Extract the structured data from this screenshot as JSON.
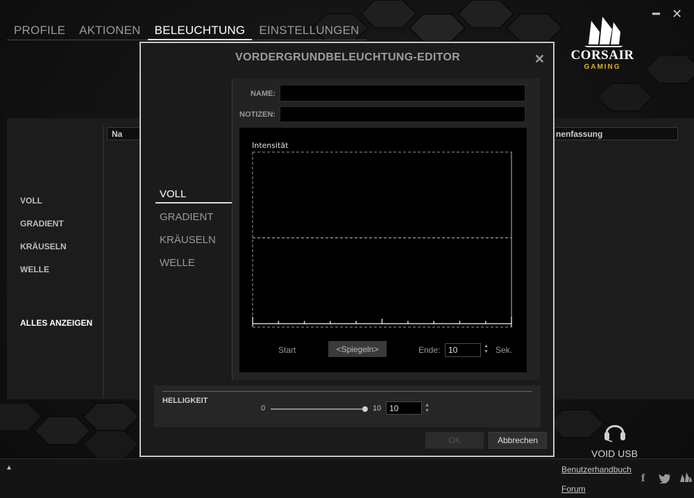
{
  "nav": {
    "tabs": [
      {
        "label": "PROFILE"
      },
      {
        "label": "AKTIONEN"
      },
      {
        "label": "BELEUCHTUNG"
      },
      {
        "label": "EINSTELLUNGEN"
      }
    ],
    "active_tab": "BELEUCHTUNG"
  },
  "window_controls": {
    "minimize": "━",
    "close": "✕"
  },
  "brand": {
    "name": "CORSAIR",
    "subtitle": "GAMING"
  },
  "background": {
    "header_left": "Na",
    "header_right": "nenfassung",
    "left_menu": [
      {
        "label": "VOLL"
      },
      {
        "label": "GRADIENT"
      },
      {
        "label": "KRÄUSELN"
      },
      {
        "label": "WELLE"
      }
    ],
    "show_all": "ALLES ANZEIGEN"
  },
  "dialog": {
    "title": "VORDERGRUNDBELEUCHTUNG-EDITOR",
    "close": "✕",
    "types": [
      {
        "label": "VOLL"
      },
      {
        "label": "GRADIENT"
      },
      {
        "label": "KRÄUSELN"
      },
      {
        "label": "WELLE"
      }
    ],
    "active_type": "VOLL",
    "name_label": "NAME:",
    "name_value": "",
    "notes_label": "NOTIZEN:",
    "notes_value": "",
    "graph": {
      "label": "Intensität",
      "intensity_level": 0.5,
      "start_label": "Start",
      "mirror_button": "<Spiegeln>",
      "end_label": "Ende:",
      "end_value": "10",
      "unit": "Sek."
    },
    "brightness": {
      "label": "HELLIGKEIT",
      "min": "0",
      "max": "10",
      "value": "10",
      "level": 1.0
    },
    "ok_button": "OK",
    "cancel_button": "Abbrechen"
  },
  "footer": {
    "device": "VOID USB",
    "manual_link": "Benutzerhandbuch",
    "forum_link": "Forum",
    "expand": "▲",
    "social": [
      {
        "icon": "facebook-icon",
        "glyph": "f"
      },
      {
        "icon": "twitter-icon",
        "glyph": "🐦"
      },
      {
        "icon": "corsair-icon",
        "glyph": "⛵"
      }
    ]
  }
}
